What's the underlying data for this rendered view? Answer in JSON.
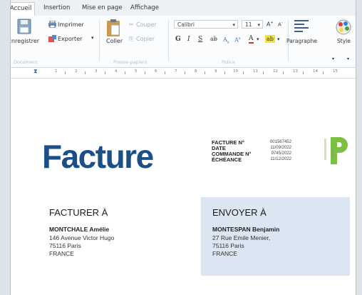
{
  "ribbon_tabs": [
    "Accueil",
    "Insertion",
    "Mise en page",
    "Affichage"
  ],
  "ribbon": {
    "save_label": "Enregistrer",
    "print_label": "Imprimer",
    "export_label": "Exporter",
    "paste_label": "Coller",
    "cut_label": "Couper",
    "copy_label": "Copier",
    "font_name": "Calibri",
    "font_size": "11",
    "paragraph_label": "Paragraphe",
    "style_label": "Style",
    "group_document": "Document",
    "group_clipboard": "Presse-papiers",
    "group_font": "Police"
  },
  "ruler": {
    "numbers": [
      "1",
      "2",
      "3",
      "4",
      "5",
      "6",
      "7",
      "8",
      "9",
      "10",
      "11",
      "12",
      "13",
      "14",
      "15"
    ]
  },
  "invoice": {
    "title": "Facture",
    "meta_labels": [
      "FACTURE N°",
      "DATE",
      "COMMANDE N°",
      "ÉCHÉANCE"
    ],
    "meta_values": [
      "001567452",
      "11/09/2022",
      "9745/2022",
      "11/12/2022"
    ],
    "logo_text": "PRODUIT",
    "bill_to": {
      "title": "FACTURER À",
      "name": "MONTCHALE Amélie",
      "lines": [
        "146 Avenue Victor Hugo",
        "75116 Paris",
        "FRANCE"
      ]
    },
    "ship_to": {
      "title": "ENVOYER À",
      "name": "MONTESPAN Benjamin",
      "lines": [
        "27 Rue Emile Menier,",
        "75116 Paris",
        "FRANCE"
      ]
    }
  },
  "colors": {
    "title_blue": "#1c4f86",
    "logo_green": "#7bc043",
    "ship_box": "#dce6f2"
  }
}
